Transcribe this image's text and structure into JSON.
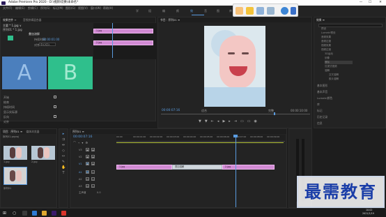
{
  "window": {
    "title": "Adobe Premiere Pro 2020 - D:\\视频\\切换\\未命名",
    "title_suffix": "*",
    "min": "—",
    "max": "☐",
    "close": "✕"
  },
  "menu": [
    "文件(F)",
    "编辑(E)",
    "剪辑(C)",
    "序列(S)",
    "标记(M)",
    "图形(G)",
    "视图(V)",
    "窗口(W)",
    "帮助(H)"
  ],
  "workspaces": [
    "学习",
    "组件",
    "编辑",
    "颜色",
    "效果",
    "音频",
    "图形",
    "库"
  ],
  "effect_controls": {
    "tabs": [
      "效果控件",
      "≡",
      "音频剪辑混合器"
    ],
    "source_line": "主要 * 1.jpg ∨",
    "sequence_line": "序列01 * 1.jpg",
    "transition_name": "叠加溶解",
    "clip_a": "A",
    "clip_b": "B",
    "duration_label": "持续时间",
    "duration": "00:00:01:00",
    "alignment_label": "对齐",
    "alignment": "中心切入",
    "start_label": "开始：",
    "start": "0.0",
    "end_label": "结束：",
    "end": "100.0",
    "show_actual": "显示实际源",
    "reverse": "反向",
    "mini_clip1": "1.jpg",
    "mini_clip2": "2.jpg",
    "params": [
      "开始",
      "结束",
      "持续时间",
      "对齐"
    ]
  },
  "program": {
    "tab": "节目：序列01 ≡",
    "timecode": "00:00:07:16",
    "fit": "适合",
    "quality": "完整",
    "duration": "00:00:10:00"
  },
  "project": {
    "tabs": [
      "项目：序列01 ≡",
      "媒体浏览器"
    ],
    "path": "序列01.prproj",
    "items": [
      {
        "name": "1.jpg"
      },
      {
        "name": "2.jpg"
      },
      {
        "name": "序列01"
      }
    ],
    "thumb_duration": "5:00"
  },
  "timeline": {
    "tab": "序列01 ≡",
    "timecode": "00:00:07:16",
    "ticks": [
      "00:00",
      "00:00:01:00",
      "00:00:02:00",
      "00:00:03:00",
      "00:00:04:00",
      "00:00:05:00",
      "00:00:06:00",
      "00:00:07:00",
      "00:00:08:00",
      "00:00:09:00"
    ],
    "tracks": [
      "V3",
      "V2",
      "V1",
      "A1",
      "A2",
      "A3"
    ],
    "clip1": "1.jpg",
    "clip2": "2.jpg",
    "transition": "叠加溶解",
    "master": "主声道",
    "master_val": "0.0"
  },
  "effects_panel": {
    "tab": "效果 ≡",
    "search": "",
    "tree": [
      "预设",
      "Lumetri预设",
      "音频效果",
      "音频过渡",
      "视频效果",
      "视频过渡",
      "3D运动",
      "划像",
      "擦除",
      "沉浸式视频",
      "溶解",
      "叠加溶解",
      "交叉溶解",
      "胶片溶解",
      "黑场过渡",
      "白场过渡"
    ],
    "categories": [
      "基本图形",
      "基本声音",
      "Lumetri颜色",
      "库",
      "标记",
      "历史记录",
      "信息"
    ]
  },
  "watermark": "最需教育",
  "taskbar": {
    "time": "10:02",
    "date": "2021/1/19"
  },
  "colors": {
    "accent": "#5a9ce0",
    "clip": "#d18ad3",
    "clip_a": "#4b7fbd",
    "clip_b": "#2fbf8c",
    "playhead": "#5a9ce0",
    "watermark": "#1b3ea8"
  }
}
